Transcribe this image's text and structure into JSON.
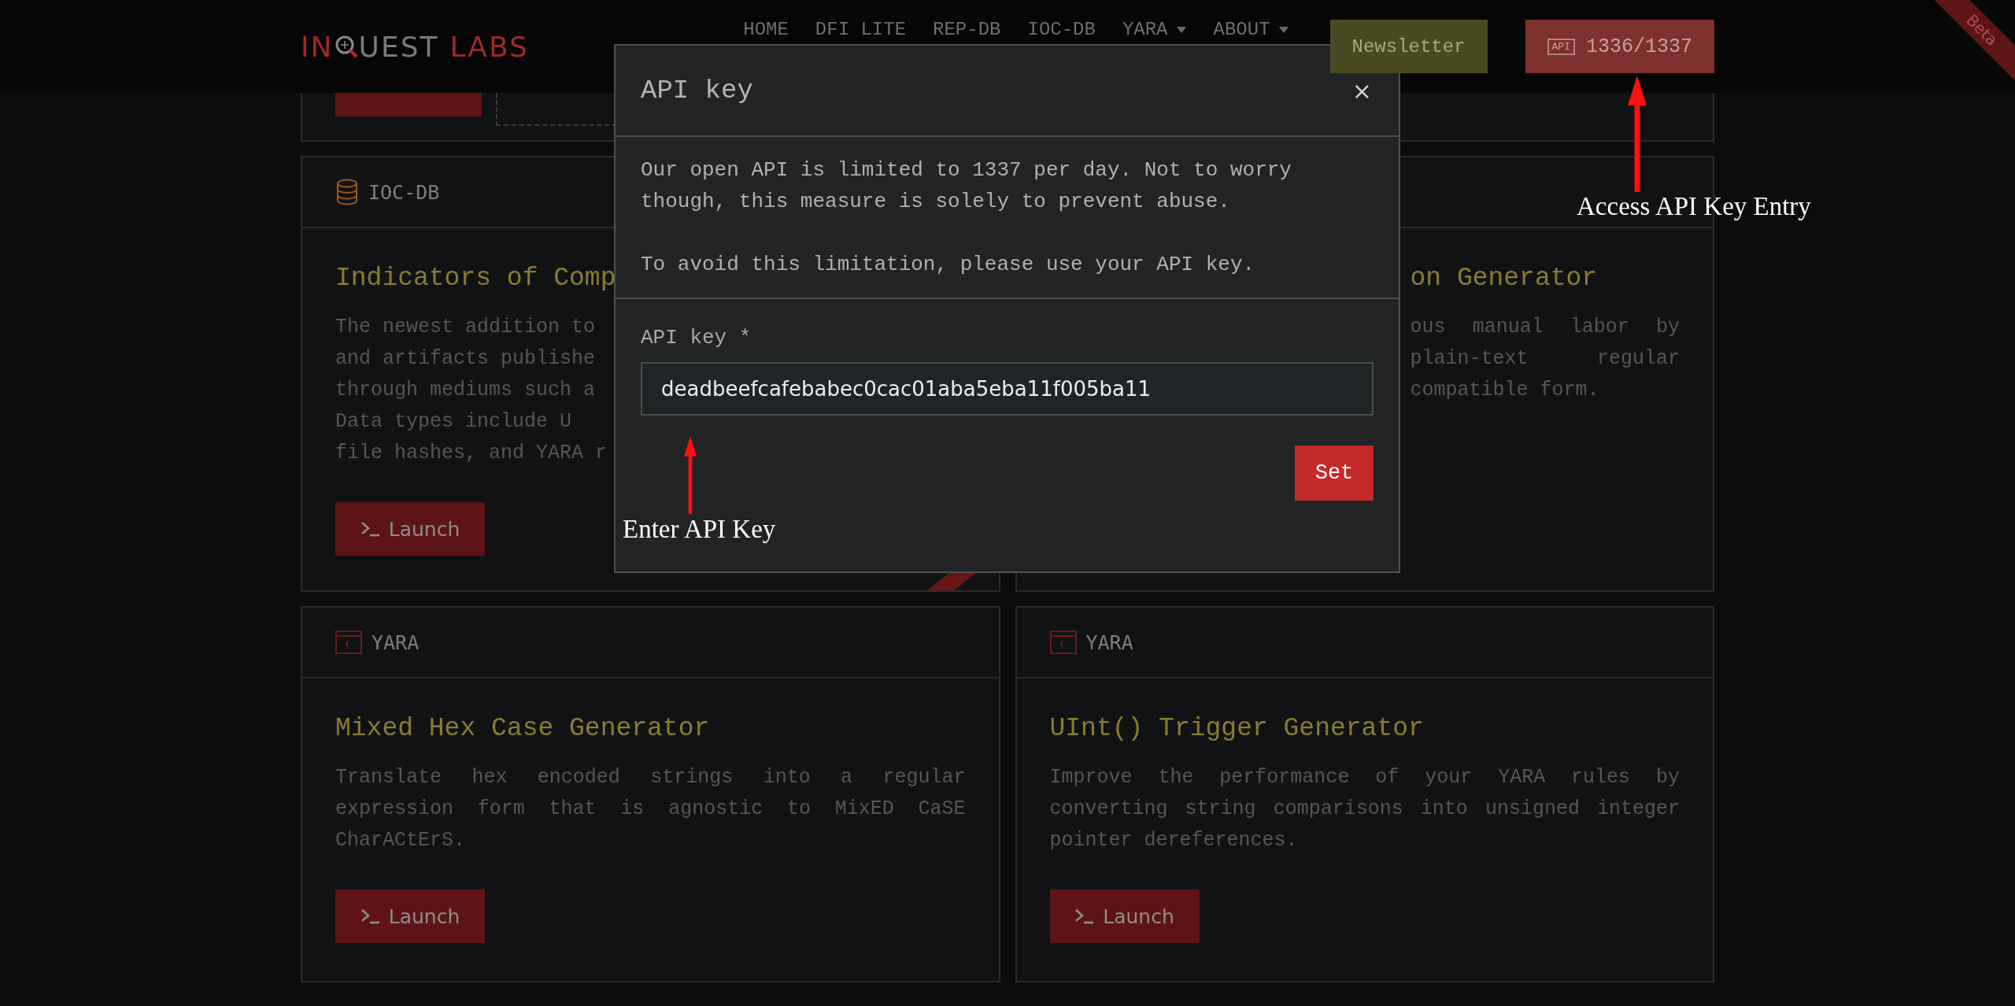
{
  "nav": {
    "logo": {
      "lead": "IN",
      "rest": "UEST",
      "suffix": "LABS"
    },
    "links": [
      {
        "label": "HOME",
        "dropdown": false
      },
      {
        "label": "DFI LITE",
        "dropdown": false
      },
      {
        "label": "REP-DB",
        "dropdown": false
      },
      {
        "label": "IOC-DB",
        "dropdown": false
      },
      {
        "label": "YARA",
        "dropdown": true
      },
      {
        "label": "ABOUT",
        "dropdown": true
      }
    ],
    "newsletter": "Newsletter",
    "api_button": {
      "badge": "API",
      "count": "1336/1337"
    },
    "ribbon": "Beta"
  },
  "cards": [
    {
      "kind": "stub"
    },
    {
      "kind": "covered-left",
      "label": "IOC-DB",
      "title": "Indicators of Comp",
      "lines": [
        "The newest addition to",
        "and artifacts publishe",
        "through mediums such a",
        "Data types include U",
        "file hashes, and YARA r"
      ],
      "button": "Launch",
      "ribbon": true
    },
    {
      "kind": "covered-right",
      "title": "on Generator",
      "lines": [
        "ous manual labor by",
        "plain-text regular",
        "compatible form."
      ]
    },
    {
      "kind": "full",
      "label": "YARA",
      "title": "Mixed Hex Case Generator",
      "description": "Translate hex encoded strings into a regular expression form that is agnostic to MixED CaSE CharACtErS.",
      "button": "Launch"
    },
    {
      "kind": "full",
      "label": "YARA",
      "title": "UInt() Trigger Generator",
      "description": "Improve the performance of your YARA rules by converting string comparisons into unsigned integer pointer dereferences.",
      "button": "Launch"
    }
  ],
  "modal": {
    "title": "API key",
    "close": "×",
    "paragraphs": [
      "Our open API is limited to 1337 per day. Not to worry though, this measure is solely to prevent abuse.",
      "To avoid this limitation, please use your API key."
    ],
    "field_label": "API key *",
    "field_value": "deadbeefcafebabec0cac01aba5eba11f005ba11",
    "submit": "Set"
  },
  "annotations": [
    {
      "text": "Access API Key Entry"
    },
    {
      "text": "Enter API Key"
    }
  ]
}
